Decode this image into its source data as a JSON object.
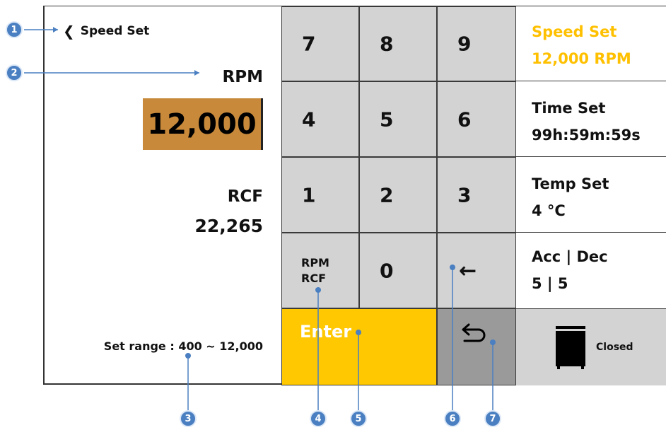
{
  "left_panel": {
    "back_label": "Speed Set",
    "rpm_label": "RPM",
    "rpm_value": "12,000",
    "rcf_label": "RCF",
    "rcf_value": "22,265",
    "set_range": "Set range : 400 ~ 12,000"
  },
  "keypad": {
    "keys": [
      "7",
      "8",
      "9",
      "4",
      "5",
      "6",
      "1",
      "2",
      "3"
    ],
    "toggle_line1": "RPM",
    "toggle_line2": "RCF",
    "zero": "0",
    "backspace_glyph": "←",
    "enter_label": "Enter"
  },
  "side_panel": {
    "speed_title": "Speed Set",
    "speed_value": "12,000 RPM",
    "time_title": "Time Set",
    "time_value": "99h:59m:59s",
    "temp_title": "Temp Set",
    "temp_value": "4 °C",
    "acc_title": "Acc | Dec",
    "acc_value": "5 | 5",
    "lid_status": "Closed"
  },
  "callouts": [
    "1",
    "2",
    "3",
    "4",
    "5",
    "6",
    "7"
  ],
  "colors": {
    "accent_yellow": "#ffc800",
    "rpm_highlight": "#c88a3a",
    "key_gray": "#d3d3d3",
    "callout_blue": "#4a7fc1"
  },
  "icons": {
    "back": "chevron-left-icon",
    "undo": "undo-arrow-icon",
    "lid": "lid-closed-icon"
  }
}
